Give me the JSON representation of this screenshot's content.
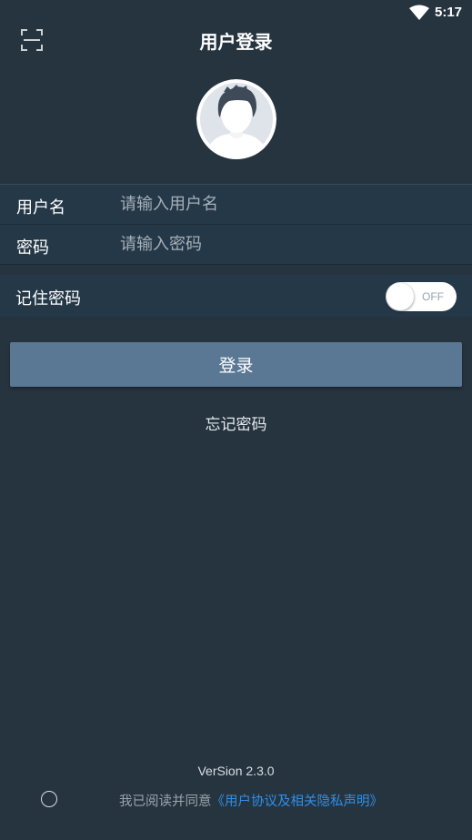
{
  "status_bar": {
    "time": "5:17",
    "icons": [
      "wifi-icon"
    ]
  },
  "header": {
    "title": "用户登录",
    "scan_icon": "scan-icon"
  },
  "avatar": {
    "icon": "user-avatar-icon"
  },
  "form": {
    "username": {
      "label": "用户名",
      "value": "",
      "placeholder": "请输入用户名"
    },
    "password": {
      "label": "密码",
      "value": "",
      "placeholder": "请输入密码"
    }
  },
  "remember": {
    "label": "记住密码",
    "toggle_text": "OFF",
    "enabled": false
  },
  "login_button": {
    "label": "登录"
  },
  "forgot_password": {
    "label": "忘记密码"
  },
  "footer": {
    "version": "VerSion 2.3.0",
    "agreement_prefix": "我已阅读并同意",
    "agreement_link": "《用户协议及相关隐私声明》",
    "agreed": false
  },
  "colors": {
    "background": "#263440",
    "panel": "#253848",
    "button": "#5a7894",
    "link": "#2f8fe8"
  }
}
